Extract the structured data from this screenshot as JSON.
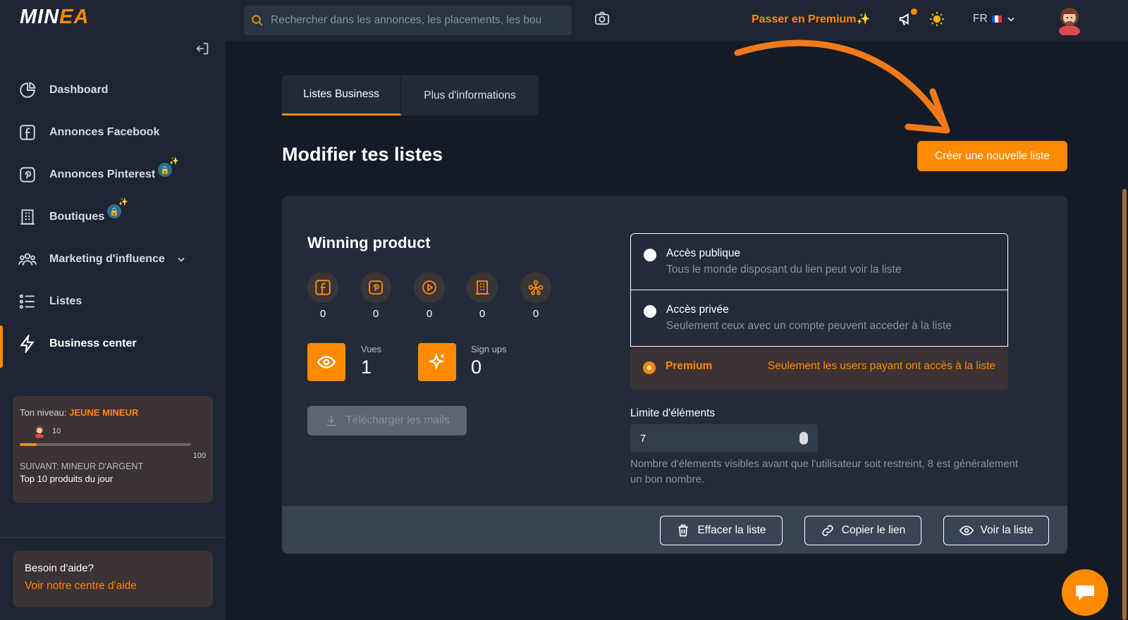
{
  "app": {
    "logo_main": "MIN",
    "logo_e": "E",
    "logo_end": "A"
  },
  "header": {
    "search_placeholder": "Rechercher dans les annonces, les placements, les bou",
    "premium_label": "Passer en Premium",
    "premium_sparkle": "✨",
    "lang": "FR"
  },
  "sidebar": {
    "items": [
      {
        "label": "Dashboard",
        "icon": "pie-chart-icon"
      },
      {
        "label": "Annonces Facebook",
        "icon": "facebook-icon"
      },
      {
        "label": "Annonces Pinterest",
        "icon": "pinterest-icon"
      },
      {
        "label": "Boutiques",
        "icon": "building-icon"
      },
      {
        "label": "Marketing d'influence",
        "icon": "people-icon"
      },
      {
        "label": "Listes",
        "icon": "list-icon"
      },
      {
        "label": "Business center",
        "icon": "bolt-icon"
      }
    ],
    "level": {
      "prefix": "Ton niveau:",
      "name": "JEUNE MINEUR",
      "current": "10",
      "max": "100",
      "progress_fraction": 0.1,
      "next": "SUIVANT: MINEUR D'ARGENT",
      "next_reward": "Top 10 produits du jour"
    },
    "help": {
      "title": "Besoin d'aide?",
      "link": "Voir notre centre d'aide"
    }
  },
  "main": {
    "tabs": [
      "Listes Business",
      "Plus d'informations"
    ],
    "title": "Modifier tes listes",
    "create_button": "Créer une nouvelle liste",
    "card": {
      "name": "Winning product",
      "sources": [
        {
          "icon": "facebook-icon",
          "count": "0"
        },
        {
          "icon": "pinterest-icon",
          "count": "0"
        },
        {
          "icon": "play-icon",
          "count": "0"
        },
        {
          "icon": "building-icon",
          "count": "0"
        },
        {
          "icon": "network-icon",
          "count": "0"
        }
      ],
      "views_label": "Vues",
      "views_value": "1",
      "signups_label": "Sign ups",
      "signups_value": "0",
      "download_button": "Télécharger les mails",
      "access": {
        "public_title": "Accès publique",
        "public_desc": "Tous le monde disposant du lien peut voir la liste",
        "private_title": "Accès privée",
        "private_desc": "Seulement ceux avec un compte peuvent acceder à la liste",
        "premium_title": "Premium",
        "premium_desc": "Seulement les users payant ont accès à la liste",
        "selected": "Premium"
      },
      "limit_label": "Limite d'éléments",
      "limit_value": "7",
      "limit_help": "Nombre d'élements visibles avant que l'utilisateur soit restreint, 8 est généralement un bon nombre.",
      "footer": {
        "clear": "Effacer la liste",
        "copy": "Copier le lien",
        "view": "Voir la liste"
      }
    }
  },
  "colors": {
    "accent": "#ff8a00",
    "bg": "#141b27",
    "panel": "#1d2533",
    "card": "#232b3a"
  }
}
